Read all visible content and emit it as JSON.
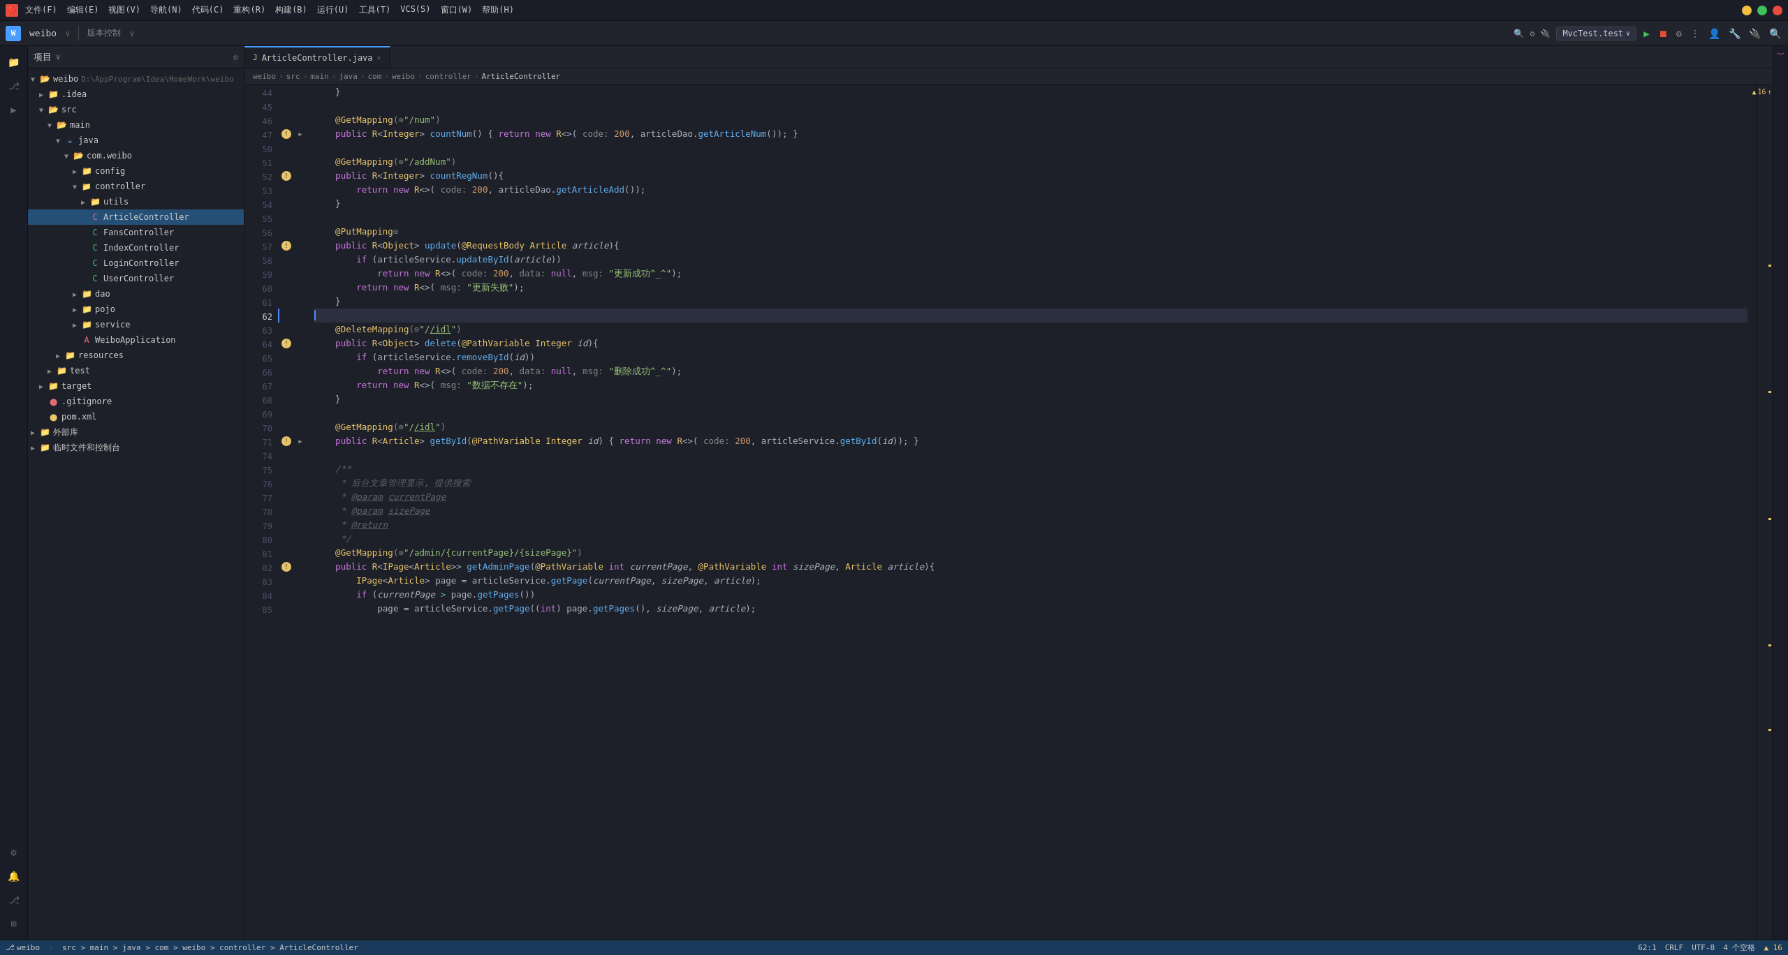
{
  "titleBar": {
    "menus": [
      "文件(F)",
      "编辑(E)",
      "视图(V)",
      "导航(N)",
      "代码(C)",
      "重构(R)",
      "构建(B)",
      "运行(U)",
      "工具(T)",
      "VCS(S)",
      "窗口(W)",
      "帮助(H)"
    ],
    "windowButtons": [
      "─",
      "□",
      "✕"
    ]
  },
  "toolbar": {
    "projectLabel": "weibo",
    "vcsLabel": "版本控制",
    "runConfig": "MvcTest.test",
    "icons": [
      "▶",
      "⏹",
      "⚙",
      "⋮"
    ]
  },
  "projectPanel": {
    "title": "项目",
    "tree": [
      {
        "id": "weibo-root",
        "label": "weibo",
        "hint": "D:\\AppProgram\\Idea\\HomeWork\\weibo",
        "level": 0,
        "type": "folder",
        "expanded": true
      },
      {
        "id": "idea",
        "label": ".idea",
        "level": 1,
        "type": "folder",
        "expanded": false
      },
      {
        "id": "src",
        "label": "src",
        "level": 1,
        "type": "folder",
        "expanded": true
      },
      {
        "id": "main",
        "label": "main",
        "level": 2,
        "type": "folder",
        "expanded": true
      },
      {
        "id": "java",
        "label": "java",
        "level": 3,
        "type": "folder-java",
        "expanded": true
      },
      {
        "id": "com-weibo",
        "label": "com.weibo",
        "level": 4,
        "type": "folder",
        "expanded": true
      },
      {
        "id": "config",
        "label": "config",
        "level": 5,
        "type": "folder",
        "expanded": false
      },
      {
        "id": "controller",
        "label": "controller",
        "level": 5,
        "type": "folder-red",
        "expanded": true
      },
      {
        "id": "utils",
        "label": "utils",
        "level": 6,
        "type": "folder",
        "expanded": false
      },
      {
        "id": "ArticleController",
        "label": "ArticleController",
        "level": 6,
        "type": "java-class",
        "selected": true
      },
      {
        "id": "FansController",
        "label": "FansController",
        "level": 6,
        "type": "java-class"
      },
      {
        "id": "IndexController",
        "label": "IndexController",
        "level": 6,
        "type": "java-class"
      },
      {
        "id": "LoginController",
        "label": "LoginController",
        "level": 6,
        "type": "java-class"
      },
      {
        "id": "UserController",
        "label": "UserController",
        "level": 6,
        "type": "java-class"
      },
      {
        "id": "dao",
        "label": "dao",
        "level": 5,
        "type": "folder",
        "expanded": false
      },
      {
        "id": "pojo",
        "label": "pojo",
        "level": 5,
        "type": "folder",
        "expanded": false
      },
      {
        "id": "service",
        "label": "service",
        "level": 5,
        "type": "folder-yellow",
        "expanded": false
      },
      {
        "id": "WeiboApplication",
        "label": "WeiboApplication",
        "level": 5,
        "type": "java-class"
      },
      {
        "id": "resources",
        "label": "resources",
        "level": 3,
        "type": "folder",
        "expanded": false
      },
      {
        "id": "test",
        "label": "test",
        "level": 2,
        "type": "folder",
        "expanded": false
      },
      {
        "id": "target",
        "label": "target",
        "level": 1,
        "type": "folder",
        "expanded": false
      },
      {
        "id": "gitignore",
        "label": ".gitignore",
        "level": 1,
        "type": "file"
      },
      {
        "id": "pom",
        "label": "pom.xml",
        "level": 1,
        "type": "xml"
      },
      {
        "id": "ext-libs",
        "label": "外部库",
        "level": 0,
        "type": "folder",
        "expanded": false
      },
      {
        "id": "scratch",
        "label": "临时文件和控制台",
        "level": 0,
        "type": "folder",
        "expanded": false
      }
    ]
  },
  "tabs": [
    {
      "id": "article-controller",
      "label": "ArticleController.java",
      "active": true,
      "closable": true
    }
  ],
  "breadcrumb": [
    "weibo",
    "src",
    "main",
    "java",
    "com",
    "weibo",
    "controller",
    "ArticleController"
  ],
  "editor": {
    "lines": [
      {
        "num": 44,
        "text": "    }",
        "gutter": ""
      },
      {
        "num": 45,
        "text": "",
        "gutter": ""
      },
      {
        "num": 46,
        "text": "    @GetMapping(\"/num\")",
        "gutter": ""
      },
      {
        "num": 47,
        "text": "    public R<Integer> countNum() { return new R<>( code: 200, articleDao.getArticleNum()); }",
        "gutter": "run"
      },
      {
        "num": 50,
        "text": "",
        "gutter": ""
      },
      {
        "num": 51,
        "text": "    @GetMapping(\"/addNum\")",
        "gutter": ""
      },
      {
        "num": 52,
        "text": "    public R<Integer> countRegNum(){",
        "gutter": "run"
      },
      {
        "num": 53,
        "text": "        return new R<>( code: 200, articleDao.getArticleAdd());",
        "gutter": ""
      },
      {
        "num": 54,
        "text": "    }",
        "gutter": ""
      },
      {
        "num": 55,
        "text": "",
        "gutter": ""
      },
      {
        "num": 56,
        "text": "    @PutMapping(⊙)",
        "gutter": ""
      },
      {
        "num": 57,
        "text": "    public R<Object> update(@RequestBody Article article){",
        "gutter": "run"
      },
      {
        "num": 58,
        "text": "        if (articleService.updateById(article))",
        "gutter": ""
      },
      {
        "num": 59,
        "text": "            return new R<>( code: 200, data: null, msg: \"更新成功^_^\");",
        "gutter": ""
      },
      {
        "num": 60,
        "text": "        return new R<>( msg: \"更新失败\");",
        "gutter": ""
      },
      {
        "num": 61,
        "text": "    }",
        "gutter": ""
      },
      {
        "num": 62,
        "text": "",
        "gutter": "",
        "current": true
      },
      {
        "num": 63,
        "text": "    @DeleteMapping(\"/\\/idl\")",
        "gutter": ""
      },
      {
        "num": 64,
        "text": "    public R<Object> delete(@PathVariable Integer id){",
        "gutter": "run"
      },
      {
        "num": 65,
        "text": "        if (articleService.removeById(id))",
        "gutter": ""
      },
      {
        "num": 66,
        "text": "            return new R<>( code: 200, data: null, msg: \"删除成功^_^\");",
        "gutter": ""
      },
      {
        "num": 67,
        "text": "        return new R<>( msg: \"数据不存在\");",
        "gutter": ""
      },
      {
        "num": 68,
        "text": "    }",
        "gutter": ""
      },
      {
        "num": 69,
        "text": "",
        "gutter": ""
      },
      {
        "num": 70,
        "text": "    @GetMapping(\"/\\/idl\")",
        "gutter": ""
      },
      {
        "num": 71,
        "text": "    public R<Article> getById(@PathVariable Integer id) { return new R<>( code: 200, articleService.getById(id)); }",
        "gutter": "run"
      },
      {
        "num": 74,
        "text": "",
        "gutter": ""
      },
      {
        "num": 75,
        "text": "    /**",
        "gutter": ""
      },
      {
        "num": 76,
        "text": "     * 后台文章管理显示, 提供搜索",
        "gutter": ""
      },
      {
        "num": 77,
        "text": "     * @param currentPage",
        "gutter": ""
      },
      {
        "num": 78,
        "text": "     * @param sizePage",
        "gutter": ""
      },
      {
        "num": 79,
        "text": "     * @return",
        "gutter": ""
      },
      {
        "num": 80,
        "text": "     */",
        "gutter": ""
      },
      {
        "num": 81,
        "text": "    @GetMapping(\"/admin/{currentPage}/{sizePage}\")",
        "gutter": ""
      },
      {
        "num": 82,
        "text": "    public R<IPage<Article>> getAdminPage(@PathVariable int currentPage, @PathVariable int sizePage, Article article){",
        "gutter": "run"
      },
      {
        "num": 83,
        "text": "        IPage<Article> page = articleService.getPage(currentPage, sizePage, article);",
        "gutter": ""
      },
      {
        "num": 84,
        "text": "        if (currentPage > page.getPages())",
        "gutter": ""
      },
      {
        "num": 85,
        "text": "            page = articleService.getPage((int) page.getPages(), sizePage, article);",
        "gutter": ""
      }
    ]
  },
  "statusBar": {
    "branch": "weibo",
    "path": "src > main > java > com > weibo > controller > ArticleController",
    "position": "62:1",
    "lineEnding": "CRLF",
    "encoding": "UTF-8",
    "indent": "4 个空格",
    "warnings": "▲ 16"
  }
}
